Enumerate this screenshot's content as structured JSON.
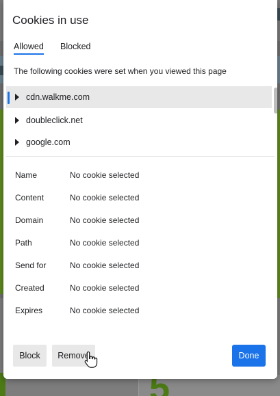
{
  "dialog": {
    "title": "Cookies in use",
    "tabs": [
      {
        "label": "Allowed",
        "active": true
      },
      {
        "label": "Blocked",
        "active": false
      }
    ],
    "description": "The following cookies were set when you viewed this page"
  },
  "sites": [
    {
      "label": "cdn.walkme.com",
      "selected": true
    },
    {
      "label": "doubleclick.net",
      "selected": false
    },
    {
      "label": "google.com",
      "selected": false
    }
  ],
  "details": [
    {
      "key": "Name",
      "value": "No cookie selected"
    },
    {
      "key": "Content",
      "value": "No cookie selected"
    },
    {
      "key": "Domain",
      "value": "No cookie selected"
    },
    {
      "key": "Path",
      "value": "No cookie selected"
    },
    {
      "key": "Send for",
      "value": "No cookie selected"
    },
    {
      "key": "Created",
      "value": "No cookie selected"
    },
    {
      "key": "Expires",
      "value": "No cookie selected"
    }
  ],
  "buttons": {
    "block": "Block",
    "remove": "Remove",
    "done": "Done"
  },
  "background": {
    "glyph": "5"
  },
  "colors": {
    "accent": "#1a73e8",
    "selected_row": "#e8e8e8"
  },
  "icons": {
    "expand": "triangle-right-icon",
    "cursor": "hand-pointer-icon"
  }
}
